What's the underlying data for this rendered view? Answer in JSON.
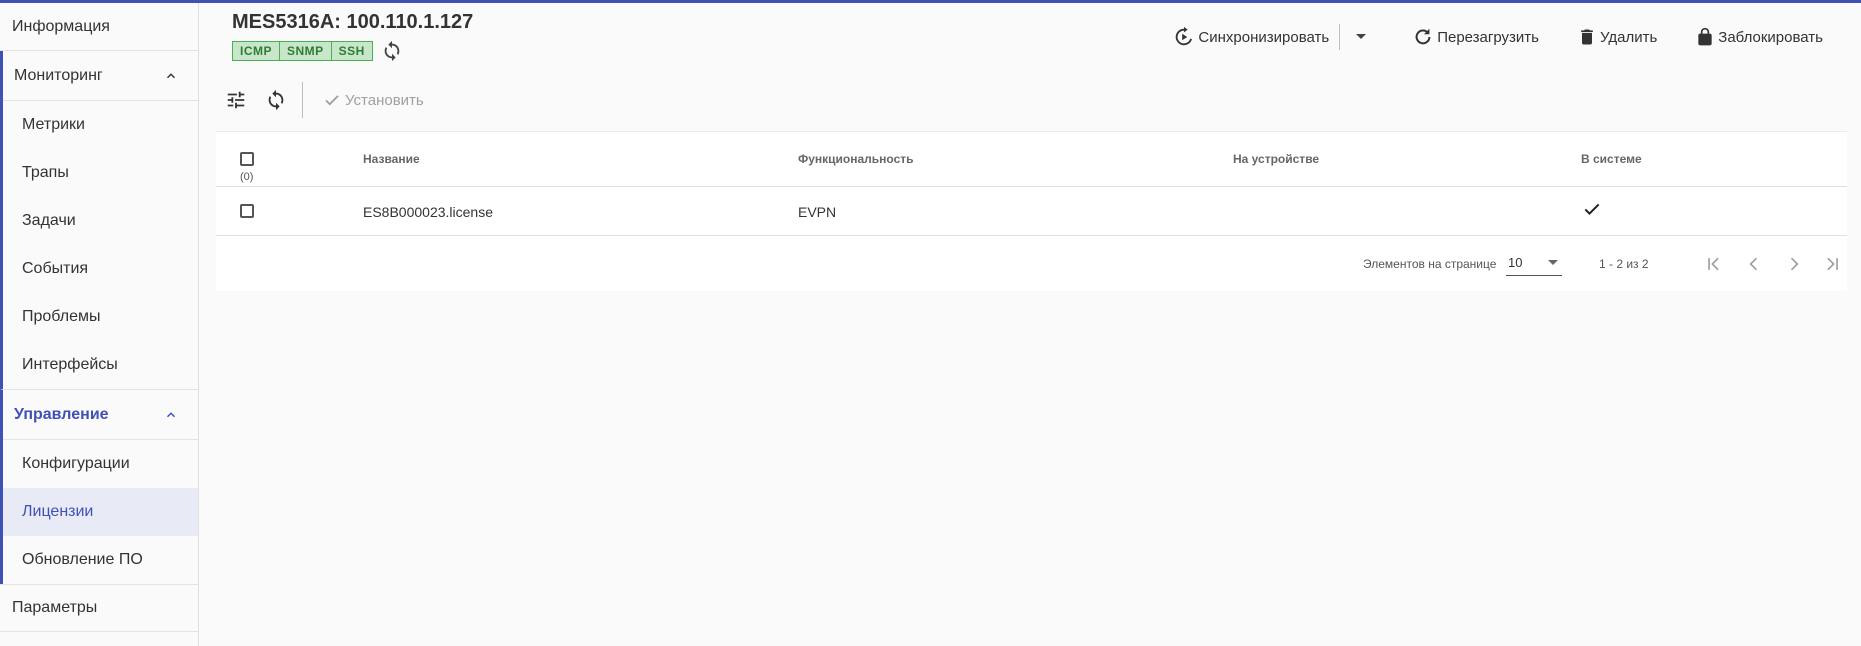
{
  "sidebar": {
    "info": "Информация",
    "monitoring": {
      "label": "Мониторинг",
      "items": [
        "Метрики",
        "Трапы",
        "Задачи",
        "События",
        "Проблемы",
        "Интерфейсы"
      ]
    },
    "management": {
      "label": "Управление",
      "items": [
        "Конфигурации",
        "Лицензии",
        "Обновление ПО"
      ],
      "selected": "Лицензии"
    },
    "params": "Параметры"
  },
  "header": {
    "title": "MES5316A: 100.110.1.127",
    "badges": [
      "ICMP",
      "SNMP",
      "SSH"
    ],
    "actions": {
      "sync": "Синхронизировать",
      "reboot": "Перезагрузить",
      "delete": "Удалить",
      "lock": "Заблокировать"
    }
  },
  "toolbar": {
    "install": "Установить"
  },
  "table": {
    "columns": [
      "Название",
      "Функциональность",
      "На устройстве",
      "В системе"
    ],
    "selected_count": "(0)",
    "rows": [
      {
        "name": "ES8B000023.license",
        "functionality": "EVPN",
        "on_device": "",
        "in_system": true
      }
    ]
  },
  "pagination": {
    "label": "Элементов на странице",
    "page_size": "10",
    "range": "1 - 2 из 2"
  },
  "colors": {
    "accent": "#3f51b5",
    "badge_bg": "#c8e6c9",
    "badge_border": "#4caf50"
  }
}
